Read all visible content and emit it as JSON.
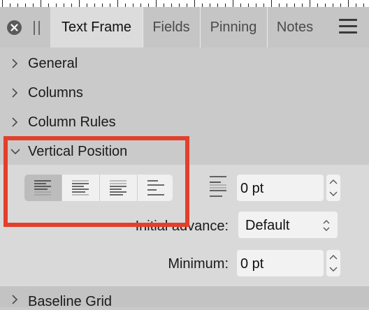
{
  "tabs": [
    {
      "label": "Text Frame",
      "active": true
    },
    {
      "label": "Fields",
      "active": false
    },
    {
      "label": "Pinning",
      "active": false
    },
    {
      "label": "Notes",
      "active": false
    }
  ],
  "icons": {
    "close": "close-icon",
    "grip": "grip-icon",
    "menu": "hamburger-menu-icon",
    "collapsed": "chevron-right-icon",
    "expanded": "chevron-down-icon",
    "leading": "leading-icon"
  },
  "sections": [
    {
      "label": "General",
      "expanded": false
    },
    {
      "label": "Columns",
      "expanded": false
    },
    {
      "label": "Column Rules",
      "expanded": false
    },
    {
      "label": "Vertical Position",
      "expanded": true
    }
  ],
  "vertical_position": {
    "alignment_options": [
      {
        "name": "align-top",
        "selected": true
      },
      {
        "name": "align-center",
        "selected": false
      },
      {
        "name": "align-bottom",
        "selected": false
      },
      {
        "name": "align-justify",
        "selected": false
      }
    ],
    "spacing_value": "0 pt",
    "initial_advance_label": "Initial advance:",
    "initial_advance_value": "Default",
    "minimum_label": "Minimum:",
    "minimum_value": "0 pt"
  },
  "footer_section": {
    "label": "Baseline Grid",
    "expanded": false
  },
  "colors": {
    "highlight": "#e2402b",
    "active_tab": "#dcdcdc",
    "panel": "#cacaca"
  }
}
